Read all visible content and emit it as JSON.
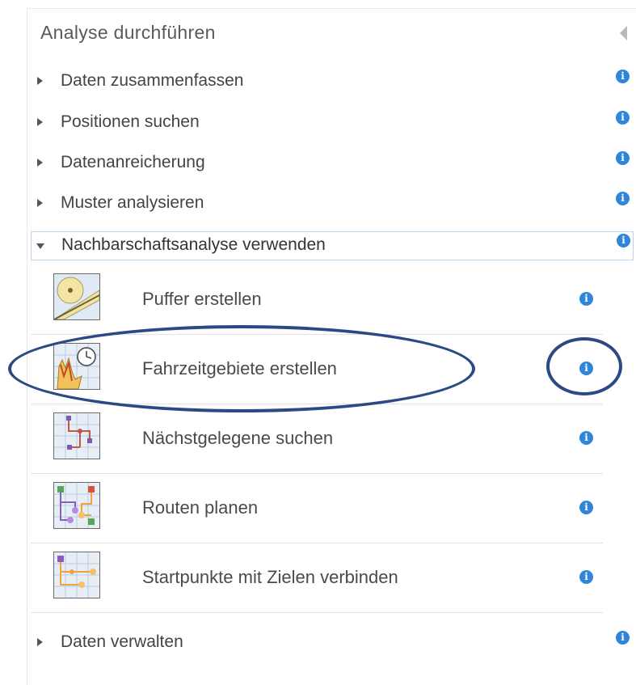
{
  "panel": {
    "title": "Analyse durchführen",
    "collapse_icon": "collapse-left-icon"
  },
  "categories": [
    {
      "label": "Daten zusammenfassen",
      "expanded": false
    },
    {
      "label": "Positionen suchen",
      "expanded": false
    },
    {
      "label": "Datenanreicherung",
      "expanded": false
    },
    {
      "label": "Muster analysieren",
      "expanded": false
    },
    {
      "label": "Nachbarschaftsanalyse verwenden",
      "expanded": true
    },
    {
      "label": "Daten verwalten",
      "expanded": false
    }
  ],
  "tools": [
    {
      "label": "Puffer erstellen",
      "icon": "buffer-tool-icon"
    },
    {
      "label": "Fahrzeitgebiete erstellen",
      "icon": "drive-time-areas-icon",
      "highlighted": true
    },
    {
      "label": "Nächstgelegene suchen",
      "icon": "find-nearest-icon"
    },
    {
      "label": "Routen planen",
      "icon": "plan-routes-icon"
    },
    {
      "label": "Startpunkte mit Zielen verbinden",
      "icon": "connect-origins-destinations-icon"
    }
  ],
  "info_glyph": "i",
  "colors": {
    "info_blue": "#2f86d8",
    "annotation_navy": "#2b4a85",
    "active_border": "#bcd3ee"
  }
}
